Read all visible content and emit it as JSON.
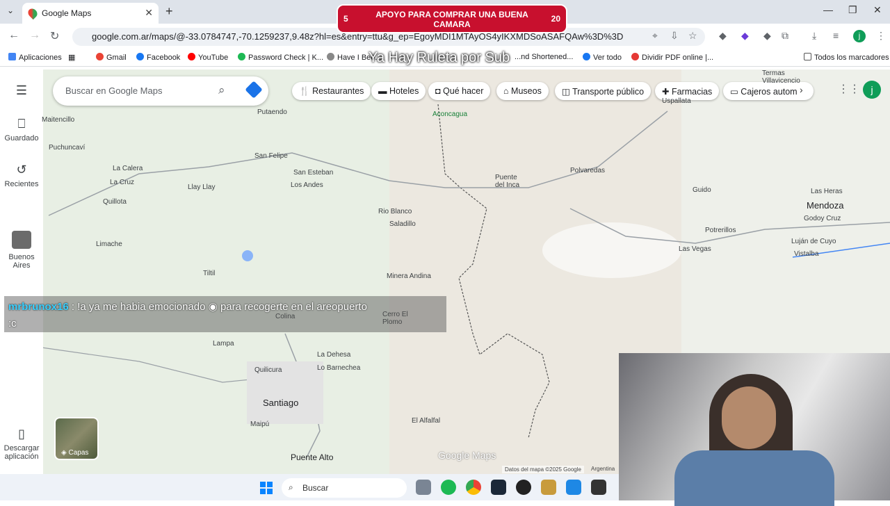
{
  "browser": {
    "tab_title": "Google Maps",
    "url": "google.com.ar/maps/@-33.0784747,-70.1259237,9.48z?hl=es&entry=ttu&g_ep=EgoyMDI1MTAyOS4yIKXMDSoASAFQAw%3D%3D",
    "bookmarks": [
      "Aplicaciones",
      "Gmail",
      "Facebook",
      "YouTube",
      "Password Check | K...",
      "Have I Bee...",
      "...nd Shortened...",
      "Ver todo",
      "Dividir PDF online |...",
      "Todos los marcadores"
    ]
  },
  "overlay": {
    "donation_left": "5",
    "donation_text": "APOYO PARA COMPRAR UNA BUENA CAMARA",
    "donation_right": "20",
    "banner": "Ya Hay Ruleta por Sub",
    "chat_user": "mrbrunox16",
    "chat_message": ": !a ya me habia emocionado",
    "chat_message2": "para recogerte en el areopuerto",
    "chat_message3": ":c"
  },
  "maps": {
    "search_placeholder": "Buscar en Google Maps",
    "left_nav": [
      "Guardado",
      "Recientes",
      "Buenos Aires",
      "Descargar aplicación"
    ],
    "chips": [
      "Restaurantes",
      "Hoteles",
      "Qué hacer",
      "Museos",
      "Transporte público",
      "Farmacias",
      "Cajeros autom"
    ],
    "avatar_letter": "j",
    "layers_label": "Capas",
    "logo": "Google Maps",
    "attribution": "Datos del mapa ©2025 Google",
    "country": "Argentina",
    "places": [
      "Putaendo",
      "Maitencillo",
      "Puchuncaví",
      "La Calera",
      "La Cruz",
      "Llay Llay",
      "Quillota",
      "San Felipe",
      "San Esteban",
      "Los Andes",
      "Rio Blanco",
      "Saladillo",
      "Aconcagua",
      "Puente del Inca",
      "Polvaredas",
      "Uspallata",
      "Termas Villavicencio",
      "Guido",
      "Las Heras",
      "Mendoza",
      "Godoy Cruz",
      "Potrerillos",
      "Las Vegas",
      "Luján de Cuyo",
      "Vistalba",
      "Limache",
      "Tiltil",
      "Minera Andina",
      "Cerro El Plomo",
      "Colina",
      "Lampa",
      "La Dehesa",
      "Lo Barnechea",
      "Quilicura",
      "Santiago",
      "Maipú",
      "El Alfalfal",
      "Puente Alto"
    ]
  },
  "taskbar": {
    "search_label": "Buscar"
  }
}
